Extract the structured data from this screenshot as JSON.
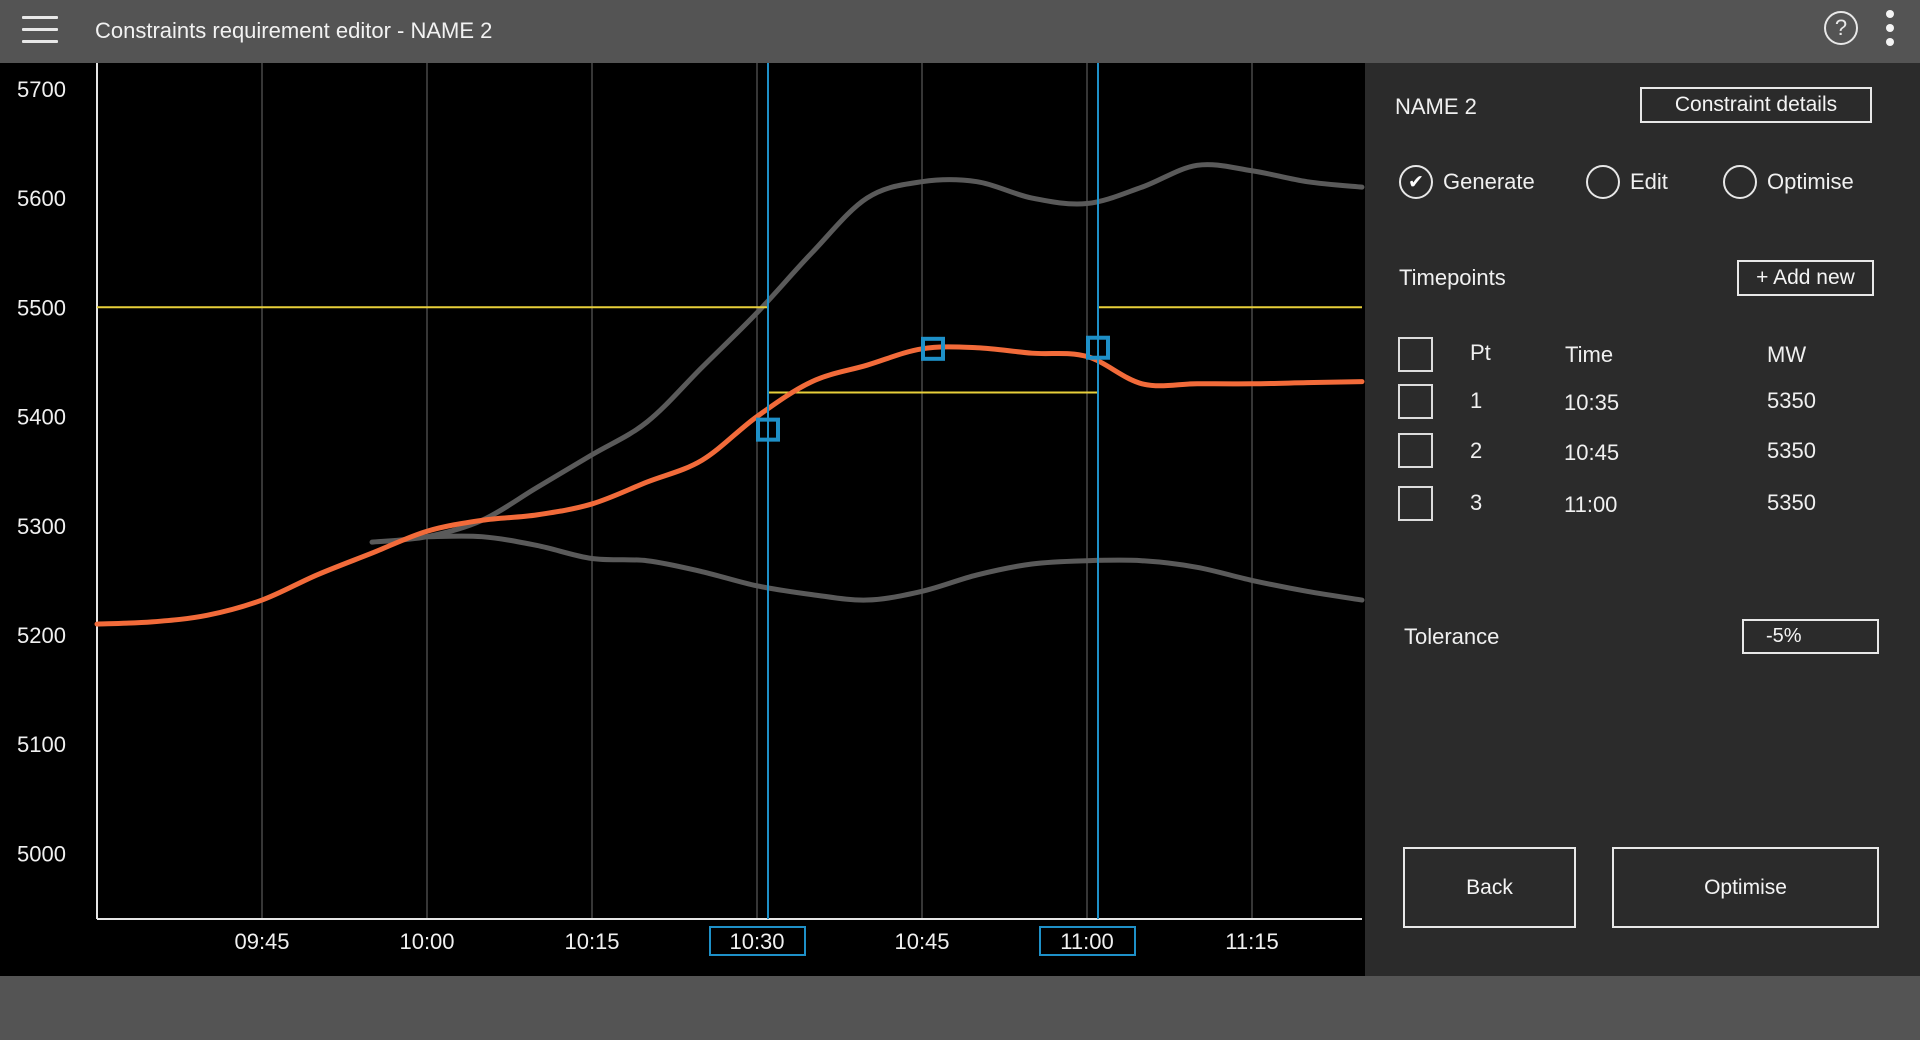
{
  "header": {
    "title": "Constraints requirement editor - NAME 2",
    "help_glyph": "?"
  },
  "icons": {
    "menu": "hamburger-menu-icon",
    "help": "help-icon",
    "more": "more-vertical-icon"
  },
  "colors": {
    "app_bg": "#545454",
    "chart_bg": "#000000",
    "panel_bg": "#2b2b2b",
    "series_main": "#f26b3a",
    "series_band": "#5a5a5a",
    "limit": "#e7cf3a",
    "marker": "#1e90c8"
  },
  "chart_data": {
    "type": "line",
    "xlabel": "",
    "ylabel": "",
    "x_ticks": [
      "09:45",
      "10:00",
      "10:15",
      "10:30",
      "10:45",
      "11:00",
      "11:15"
    ],
    "y_ticks": [
      "5700",
      "5600",
      "5500",
      "5400",
      "5300",
      "5200",
      "5100",
      "5000"
    ],
    "highlighted_ticks": [
      "10:30",
      "11:00"
    ],
    "grid": "vertical",
    "series": [
      {
        "role": "forecast",
        "x": [
          "09:30",
          "09:35",
          "09:40",
          "09:45",
          "09:50",
          "09:55",
          "10:00",
          "10:05",
          "10:10",
          "10:15",
          "10:20",
          "10:25",
          "10:30",
          "10:35",
          "10:40",
          "10:45",
          "10:50",
          "10:55",
          "11:00",
          "11:05",
          "11:10",
          "11:15",
          "11:20",
          "11:25"
        ],
        "values": [
          5210,
          5212,
          5218,
          5232,
          5255,
          5275,
          5295,
          5305,
          5310,
          5320,
          5340,
          5360,
          5400,
          5432,
          5447,
          5462,
          5463,
          5458,
          5455,
          5430,
          5430,
          5430,
          5431,
          5432
        ]
      },
      {
        "role": "upper-band",
        "x": [
          "09:55",
          "10:00",
          "10:05",
          "10:10",
          "10:15",
          "10:20",
          "10:25",
          "10:30",
          "10:35",
          "10:40",
          "10:45",
          "10:50",
          "10:55",
          "11:00",
          "11:05",
          "11:10",
          "11:15",
          "11:20",
          "11:25"
        ],
        "values": [
          5285,
          5290,
          5305,
          5335,
          5365,
          5395,
          5445,
          5495,
          5550,
          5600,
          5615,
          5615,
          5600,
          5595,
          5610,
          5630,
          5625,
          5615,
          5610
        ]
      },
      {
        "role": "lower-band",
        "x": [
          "10:00",
          "10:05",
          "10:10",
          "10:15",
          "10:20",
          "10:25",
          "10:30",
          "10:35",
          "10:40",
          "10:45",
          "10:50",
          "10:55",
          "11:00",
          "11:05",
          "11:10",
          "11:15",
          "11:20",
          "11:25"
        ],
        "values": [
          5290,
          5290,
          5282,
          5270,
          5268,
          5258,
          5245,
          5237,
          5232,
          5240,
          5255,
          5265,
          5268,
          5268,
          5262,
          5250,
          5240,
          5232
        ]
      },
      {
        "role": "limit",
        "x": [
          "09:30",
          "10:31",
          "10:31",
          "11:01",
          "11:01",
          "11:25"
        ],
        "values": [
          5500,
          5500,
          5422,
          5422,
          5500,
          5500
        ]
      }
    ],
    "markers": [
      {
        "x": "10:31",
        "y": 5388
      },
      {
        "x": "10:46",
        "y": 5462
      },
      {
        "x": "11:01",
        "y": 5463
      }
    ],
    "cursors": [
      "10:31",
      "11:01"
    ],
    "ylim": [
      4940,
      5720
    ],
    "xlim": [
      "09:30",
      "11:25"
    ]
  },
  "panel": {
    "name": "NAME 2",
    "details_button": "Constraint details",
    "modes": [
      {
        "label": "Generate",
        "selected": true,
        "check_glyph": "✔"
      },
      {
        "label": "Edit",
        "selected": false,
        "check_glyph": ""
      },
      {
        "label": "Optimise",
        "selected": false,
        "check_glyph": ""
      }
    ],
    "timepoints_label": "Timepoints",
    "add_new_button": "+ Add new",
    "columns": [
      "Pt",
      "Time",
      "MW"
    ],
    "rows": [
      {
        "pt": "1",
        "time": "10:35",
        "mw": "5350"
      },
      {
        "pt": "2",
        "time": "10:45",
        "mw": "5350"
      },
      {
        "pt": "3",
        "time": "11:00",
        "mw": "5350"
      }
    ],
    "tolerance_label": "Tolerance",
    "tolerance_value": "-5%",
    "back_button": "Back",
    "optimise_button": "Optimise"
  }
}
